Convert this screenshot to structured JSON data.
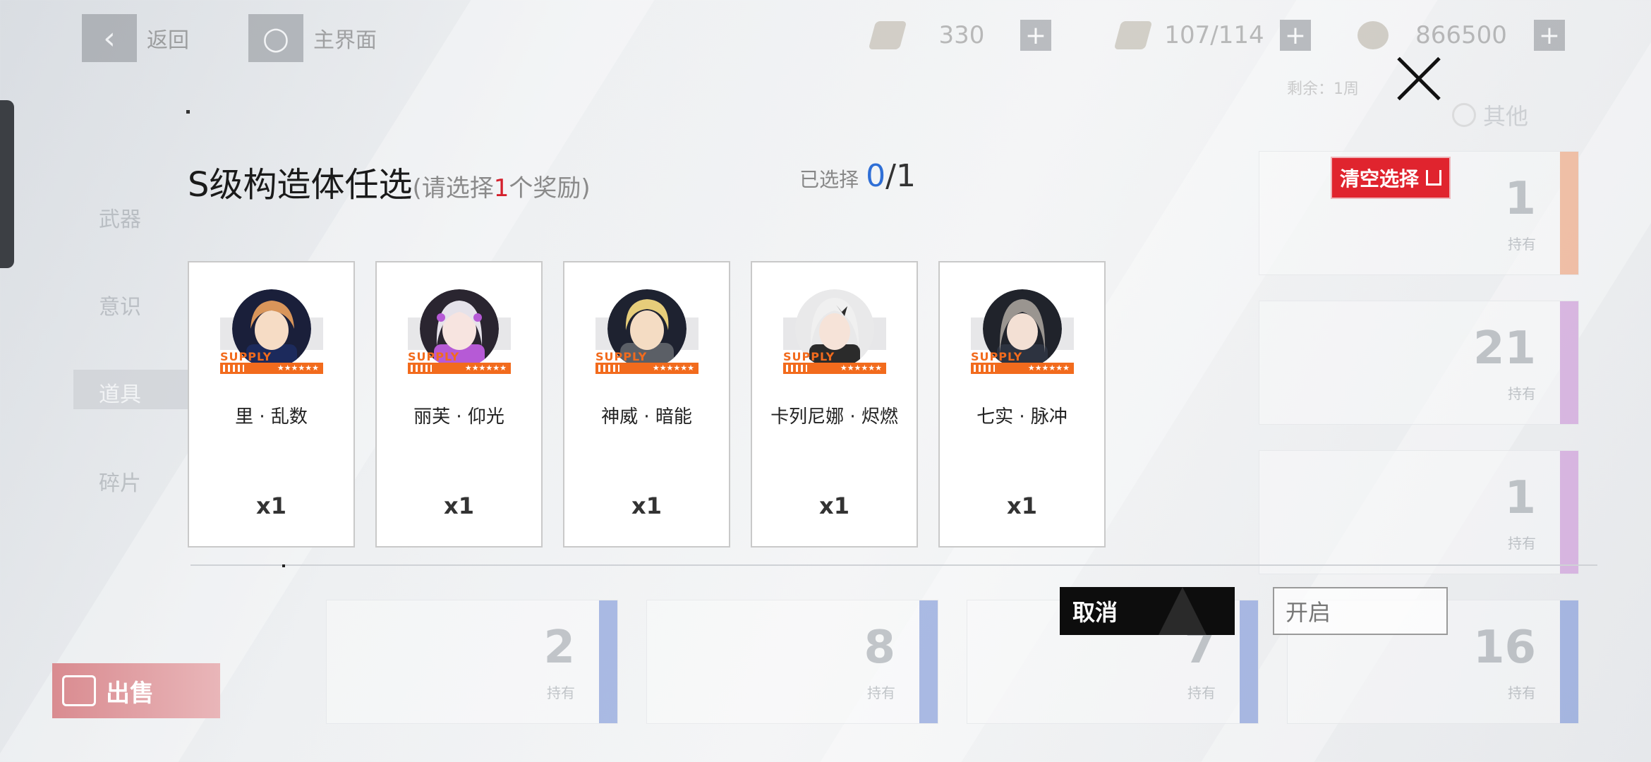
{
  "header": {
    "back_label": "返回",
    "home_label": "主界面",
    "resources": [
      {
        "icon": "ticket-icon",
        "value": "330"
      },
      {
        "icon": "stamina-icon",
        "value": "107/114"
      },
      {
        "icon": "coin-icon",
        "value": "866500"
      }
    ],
    "remain_label": "剩余：1周"
  },
  "background": {
    "filter_other": "其他",
    "tabs": [
      "武器",
      "意识",
      "道具",
      "碎片"
    ],
    "selected_tab": "道具",
    "sell_label": "出售",
    "owned_label": "持有",
    "cards": [
      {
        "count": "1",
        "color": "#f39a6b"
      },
      {
        "count": "21",
        "color": "#c98ad6"
      },
      {
        "count": "1",
        "color": "#c98ad6"
      },
      {
        "count": "16",
        "color": "#6f8bd6"
      },
      {
        "count": "2",
        "color": "#6f8bd6"
      },
      {
        "count": "8",
        "color": "#6f8bd6"
      },
      {
        "count": "7",
        "color": "#6f8bd6"
      }
    ]
  },
  "dialog": {
    "title": "S级构造体任选",
    "subtitle_pre": "(请选择",
    "subtitle_num": "1",
    "subtitle_post": "个奖励)",
    "selected_label": "已选择",
    "selected_count": "0",
    "selected_total": "/1",
    "clear_label": "清空选择",
    "cancel_label": "取消",
    "open_label": "开启",
    "supply_text": "SUPPLY",
    "stars": "★★★★★★",
    "cards": [
      {
        "name": "里 · 乱数",
        "qty": "x1",
        "hair": "#d9955a",
        "skin": "#f6dcc5",
        "cloth": "#1c2a5c"
      },
      {
        "name": "丽芙 · 仰光",
        "qty": "x1",
        "hair": "#e5e2ea",
        "skin": "#f7e4e0",
        "cloth": "#b65ad6"
      },
      {
        "name": "神威 · 暗能",
        "qty": "x1",
        "hair": "#e6cd7a",
        "skin": "#f4dcc3",
        "cloth": "#5b5f66"
      },
      {
        "name": "卡列尼娜 · 烬燃",
        "qty": "x1",
        "hair": "#f0f0f0",
        "skin": "#f6e3d8",
        "cloth": "#2b2b2b"
      },
      {
        "name": "七实 · 脉冲",
        "qty": "x1",
        "hair": "#9a9590",
        "skin": "#f3e0d4",
        "cloth": "#2d3340"
      }
    ]
  }
}
